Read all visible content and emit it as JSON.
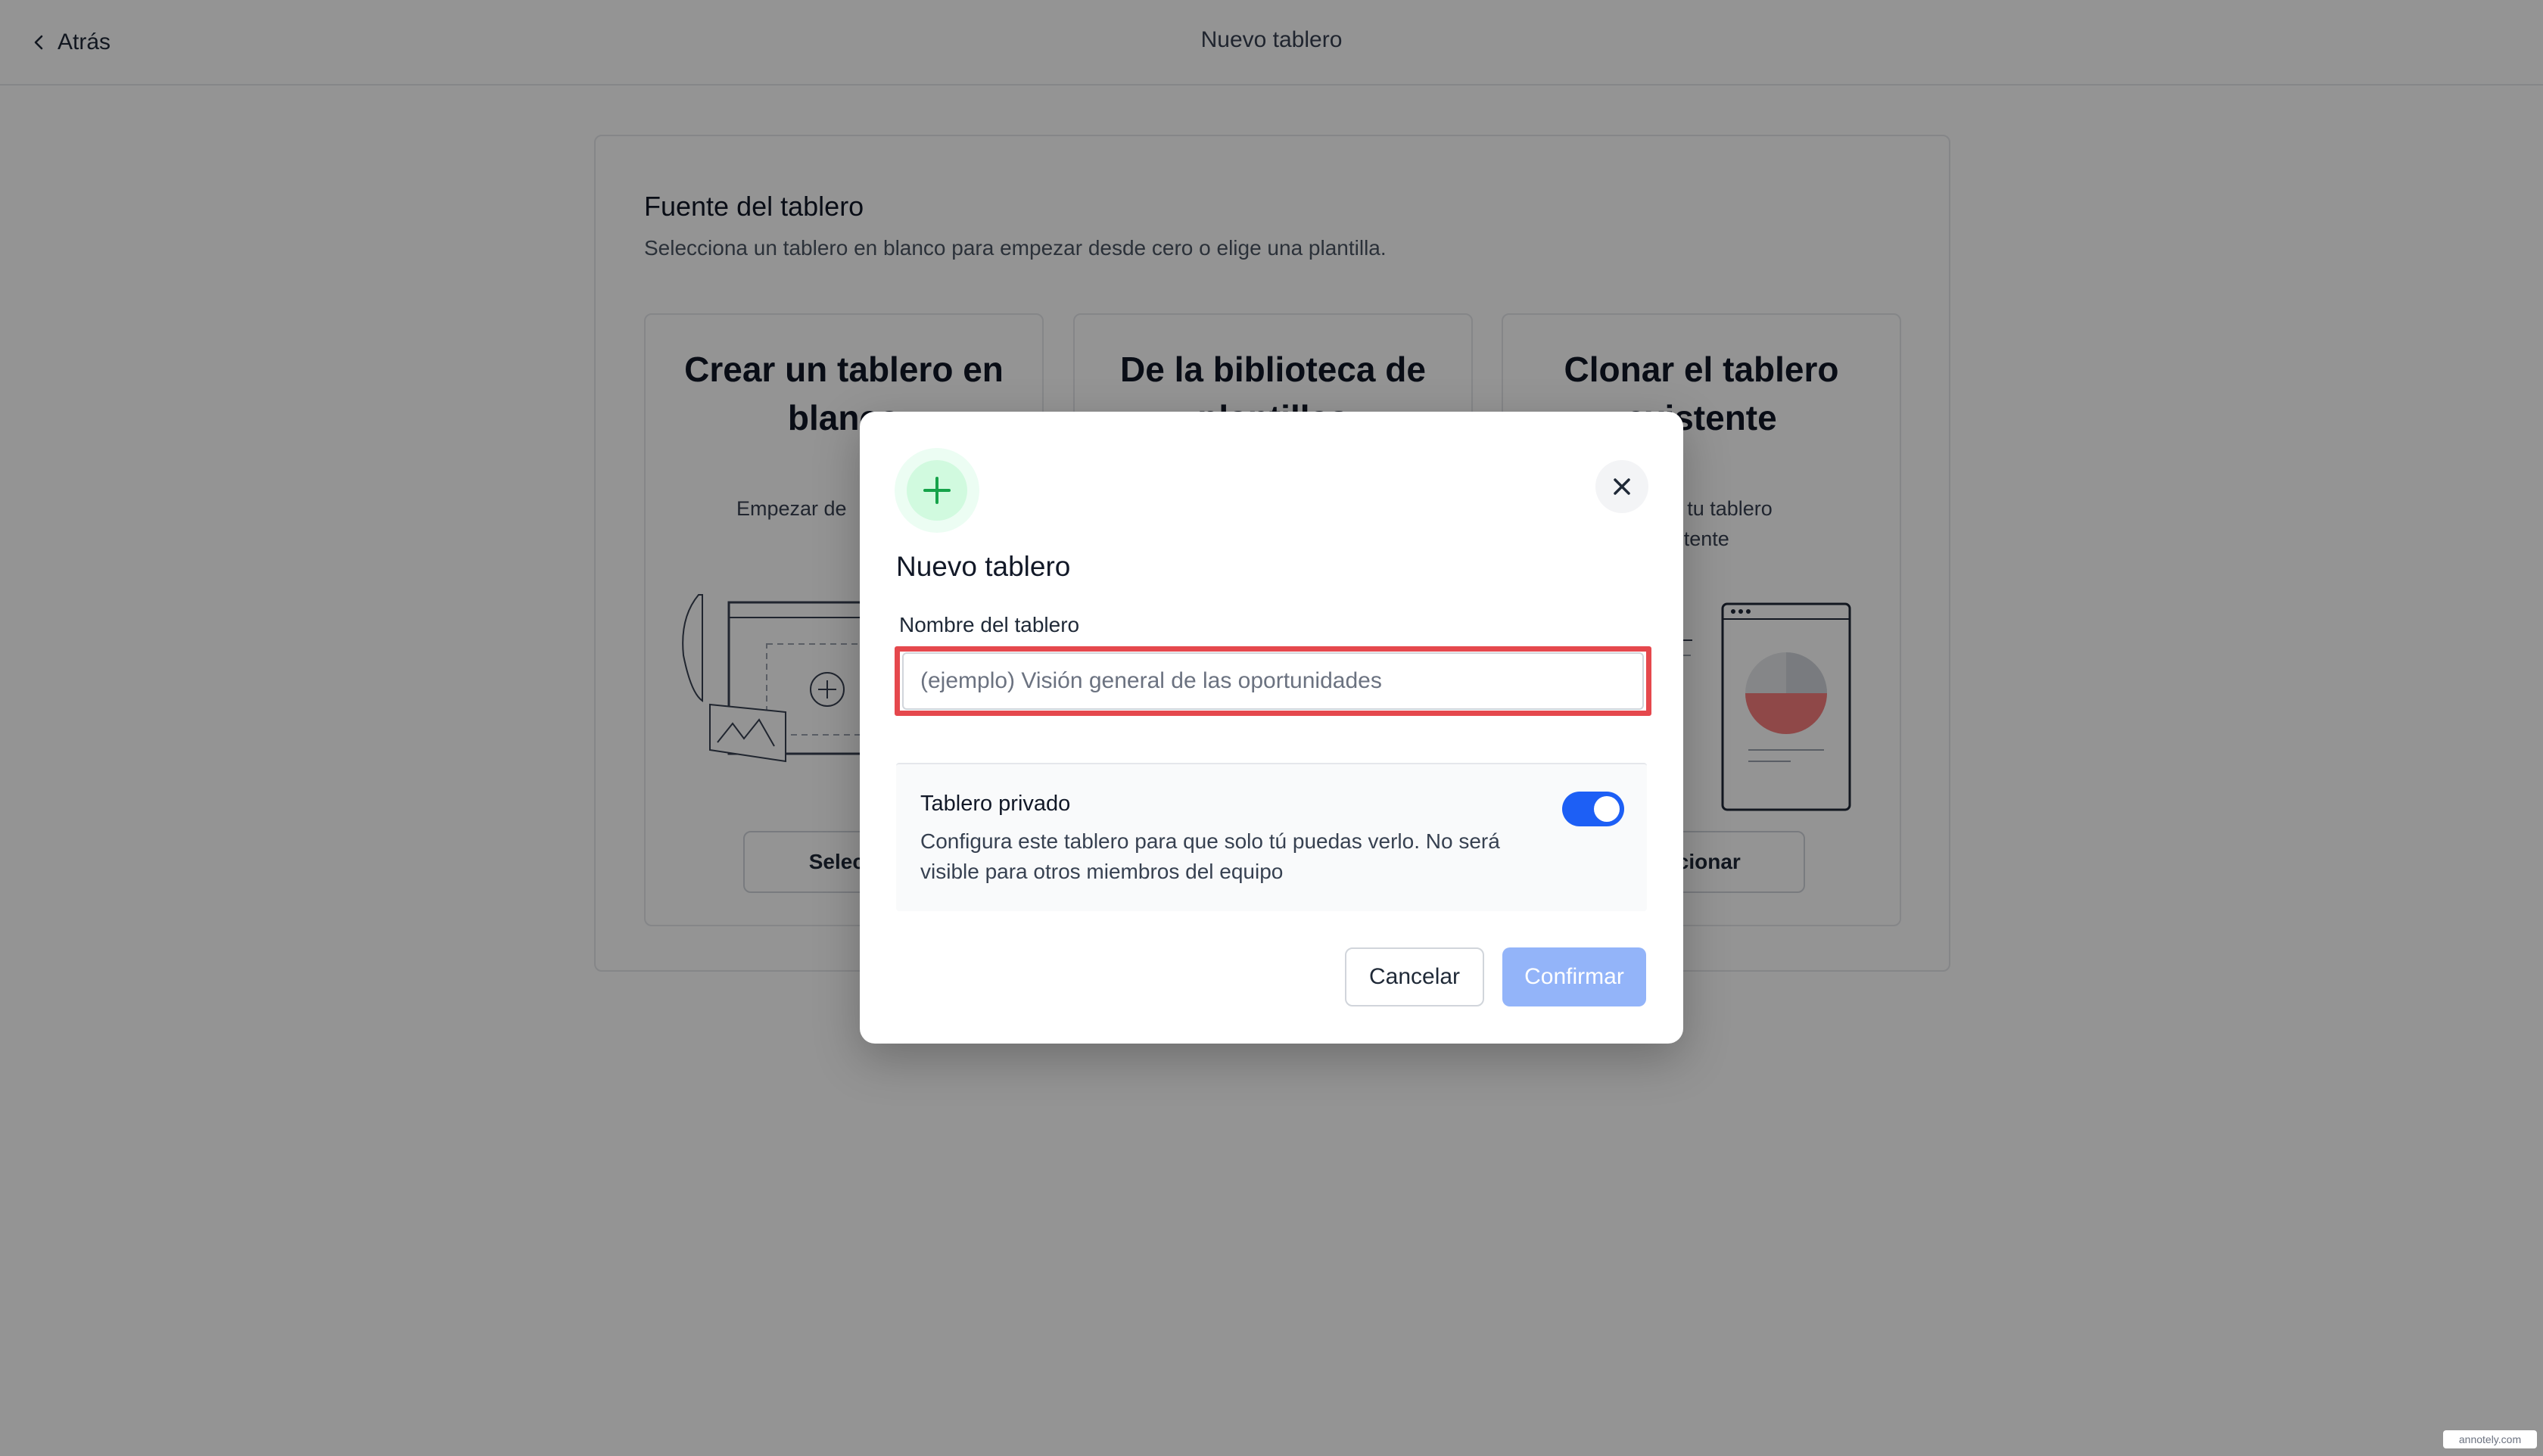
{
  "topbar": {
    "back_label": "Atrás",
    "title": "Nuevo tablero"
  },
  "source_panel": {
    "title": "Fuente del tablero",
    "subtitle": "Selecciona un tablero en blanco para empezar desde cero o elige una plantilla.",
    "cards": [
      {
        "title": "Crear un tablero en blanco",
        "description": "Empezar de",
        "button_label": "Selecci"
      },
      {
        "title": "De la biblioteca de plantillas",
        "description": "",
        "button_label": ""
      },
      {
        "title": "Clonar el tablero existente",
        "description": "on de tu tablero\nstente",
        "button_label": "ccionar"
      }
    ]
  },
  "modal": {
    "icon": "plus-icon",
    "title": "Nuevo tablero",
    "name_field": {
      "label": "Nombre del tablero",
      "value": "",
      "placeholder": "(ejemplo) Visión general de las oportunidades"
    },
    "private": {
      "title": "Tablero privado",
      "description": "Configura este tablero para que solo tú puedas verlo. No será visible para otros miembros del equipo",
      "enabled": true
    },
    "cancel_label": "Cancelar",
    "confirm_label": "Confirmar"
  },
  "watermark": "annotely.com",
  "colors": {
    "accent": "#1d5ff5",
    "confirm_disabled": "#93b4f9",
    "highlight": "#e5484d",
    "badge_green": "#16a34a"
  }
}
